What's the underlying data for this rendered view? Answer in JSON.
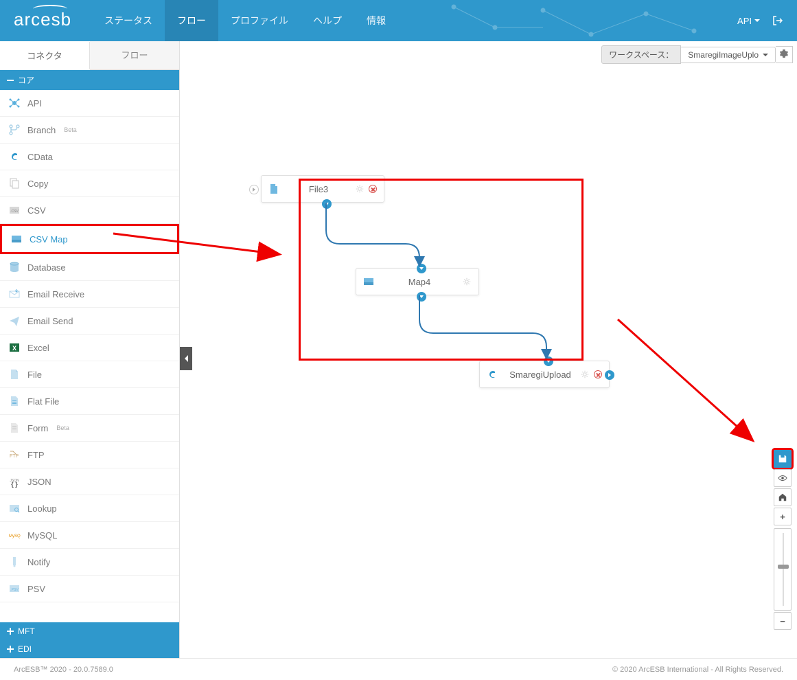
{
  "header": {
    "logo": "arcesb",
    "nav": [
      "ステータス",
      "フロー",
      "プロファイル",
      "ヘルプ",
      "情報"
    ],
    "active_nav": "フロー",
    "api_label": "API"
  },
  "workspace": {
    "label": "ワークスペース：",
    "selected": "SmaregiImageUplo"
  },
  "sidebar": {
    "tabs": [
      "コネクタ",
      "フロー"
    ],
    "active_tab": "コネクタ",
    "categories": {
      "core": {
        "label": "コア"
      },
      "mft": {
        "label": "MFT"
      },
      "edi": {
        "label": "EDI"
      }
    },
    "items": [
      {
        "label": "API",
        "icon": "api"
      },
      {
        "label": "Branch",
        "icon": "branch",
        "beta": "Beta"
      },
      {
        "label": "CData",
        "icon": "cdata"
      },
      {
        "label": "Copy",
        "icon": "copy"
      },
      {
        "label": "CSV",
        "icon": "csv"
      },
      {
        "label": "CSV Map",
        "icon": "csvmap",
        "highlighted": true
      },
      {
        "label": "Database",
        "icon": "database"
      },
      {
        "label": "Email Receive",
        "icon": "emailrecv"
      },
      {
        "label": "Email Send",
        "icon": "emailsend"
      },
      {
        "label": "Excel",
        "icon": "excel"
      },
      {
        "label": "File",
        "icon": "file"
      },
      {
        "label": "Flat File",
        "icon": "flatfile"
      },
      {
        "label": "Form",
        "icon": "form",
        "beta": "Beta"
      },
      {
        "label": "FTP",
        "icon": "ftp"
      },
      {
        "label": "JSON",
        "icon": "json"
      },
      {
        "label": "Lookup",
        "icon": "lookup"
      },
      {
        "label": "MySQL",
        "icon": "mysql"
      },
      {
        "label": "Notify",
        "icon": "notify"
      },
      {
        "label": "PSV",
        "icon": "psv"
      }
    ]
  },
  "canvas": {
    "nodes": {
      "file3": {
        "label": "File3"
      },
      "map4": {
        "label": "Map4"
      },
      "smaregi": {
        "label": "SmaregiUpload"
      }
    }
  },
  "footer": {
    "left": "ArcESB™ 2020 - 20.0.7589.0",
    "right": "© 2020 ArcESB International - All Rights Reserved."
  }
}
